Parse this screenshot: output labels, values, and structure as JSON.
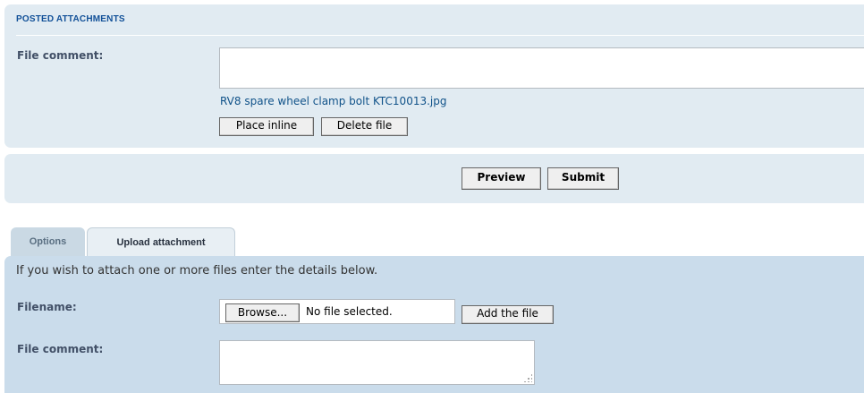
{
  "posted_attachments": {
    "title": "POSTED ATTACHMENTS",
    "comment_label": "File comment:",
    "comment_value": "",
    "filename": "RV8 spare wheel clamp bolt KTC10013.jpg",
    "place_inline_label": "Place inline",
    "delete_file_label": "Delete file"
  },
  "submit_bar": {
    "preview_label": "Preview",
    "submit_label": "Submit"
  },
  "tabs": [
    {
      "label": "Options",
      "active": false
    },
    {
      "label": "Upload attachment",
      "active": true
    }
  ],
  "upload": {
    "intro": "If you wish to attach one or more files enter the details below.",
    "filename_label": "Filename:",
    "browse_label": "Browse...",
    "no_file_text": "No file selected.",
    "add_file_label": "Add the file",
    "comment_label": "File comment:",
    "comment_value": ""
  },
  "colors": {
    "panel": "#e1ebf2",
    "upload_panel": "#cadceb",
    "title": "#115098",
    "link": "#105289"
  }
}
